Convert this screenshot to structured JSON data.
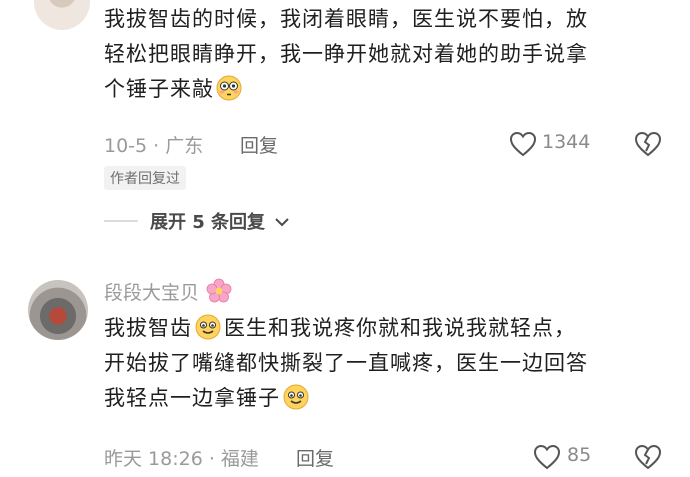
{
  "comment1": {
    "line1": "我拔智齿的时候，我闭着眼睛，医生说不要怕，放",
    "line2": "轻松把眼睛睁开，我一睁开她就对着她的助手说拿",
    "line3": "个锤子来敲",
    "emoji": "flushed-emoji",
    "meta": "10-5 · 广东",
    "reply_label": "回复",
    "likes": "1344",
    "badge": "作者回复过",
    "expand": "展开 5 条回复"
  },
  "comment2": {
    "username": "段段大宝贝",
    "name_emoji": "flower-emoji",
    "line1a": "我拔智齿",
    "line1b": "医生和我说疼你就和我说我就轻点，",
    "line2": "开始拔了嘴缝都快撕裂了一直喊疼，医生一边回答",
    "line3": "我轻点一边拿锤子",
    "emoji": "smile-emoji",
    "meta": "昨天 18:26 · 福建",
    "reply_label": "回复",
    "likes": "85"
  }
}
